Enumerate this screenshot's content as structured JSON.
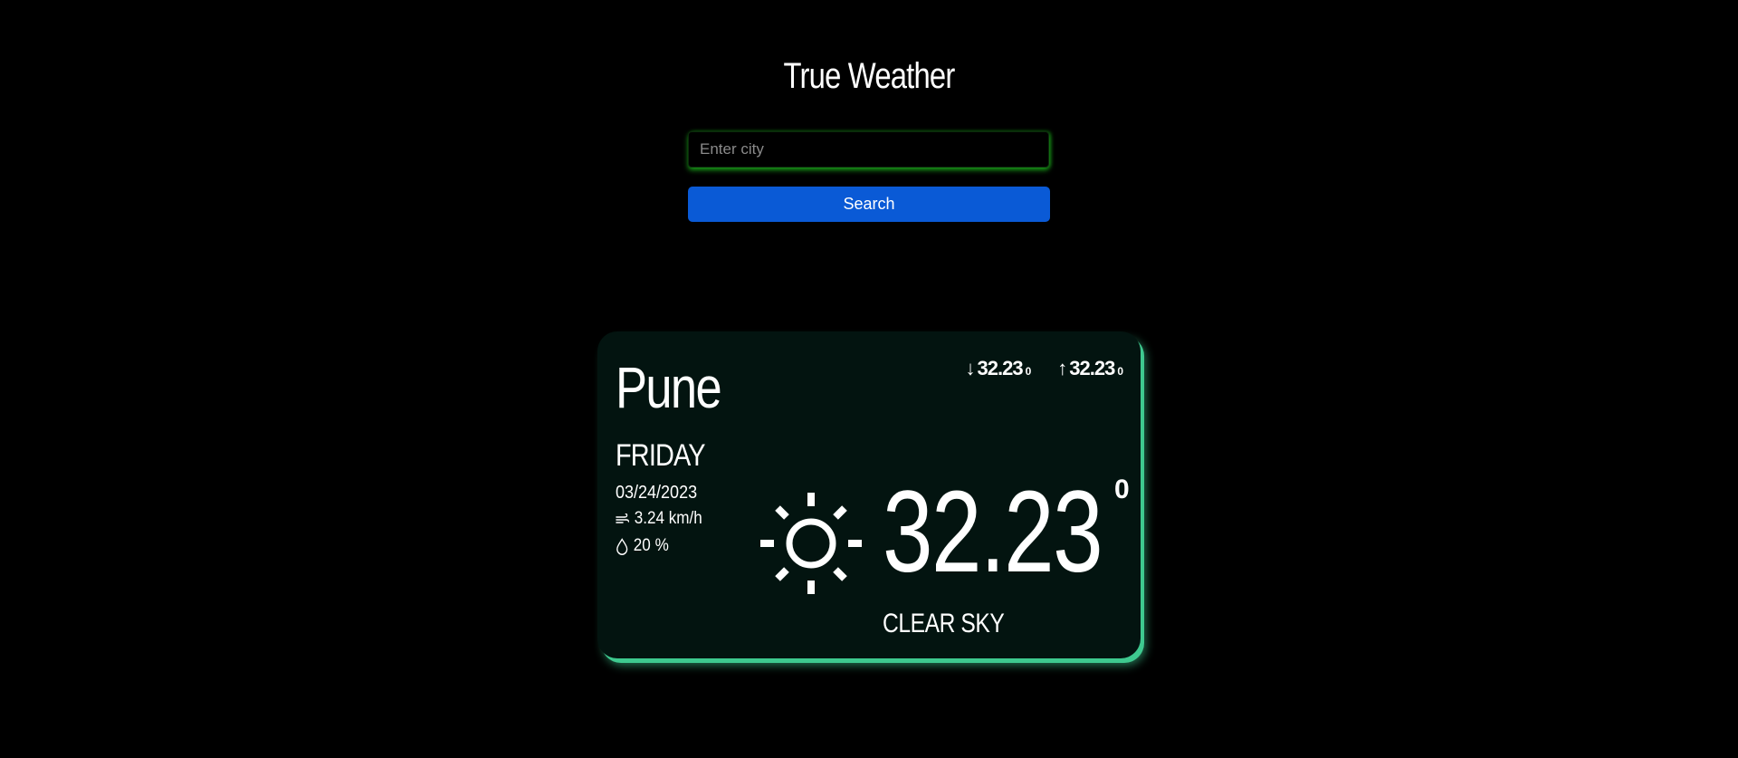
{
  "app": {
    "title": "True Weather"
  },
  "search": {
    "placeholder": "Enter city",
    "value": "",
    "button_label": "Search"
  },
  "weather": {
    "city": "Pune",
    "day": "FRIDAY",
    "date": "03/24/2023",
    "wind": "3.24 km/h",
    "humidity": "20 %",
    "temp_min": "32.23",
    "temp_max": "32.23",
    "temp_min_unit": "0",
    "temp_max_unit": "0",
    "temperature": "32.23",
    "temperature_unit": "0",
    "description": "CLEAR SKY",
    "icon": "sun-icon"
  },
  "colors": {
    "background": "#000000",
    "card_background": "#031410",
    "card_glow": "#3ec98f",
    "input_glow": "#1ebe1e",
    "button": "#0a5ad6",
    "text": "#ffffff"
  }
}
